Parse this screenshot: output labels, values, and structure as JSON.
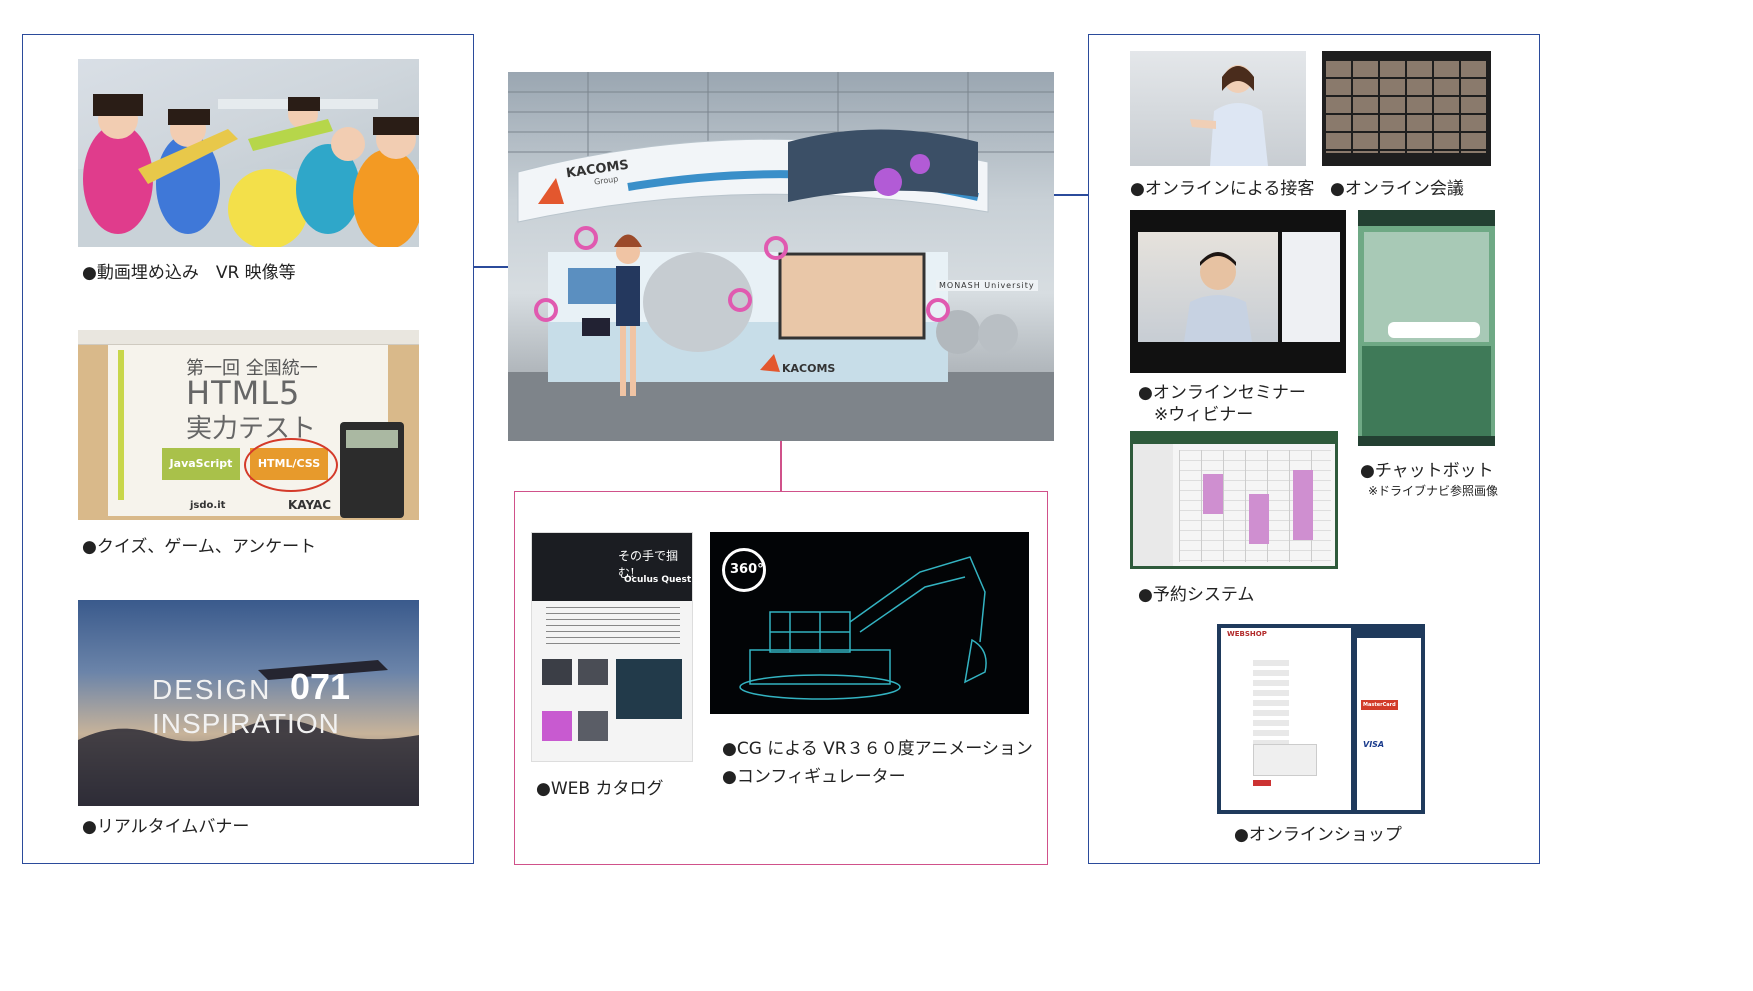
{
  "left_panel": {
    "captions": {
      "video": "●動画埋め込み　VR 映像等",
      "quiz": "●クイズ、ゲーム、アンケート",
      "banner": "●リアルタイムバナー"
    },
    "quiz_image": {
      "title_line1": "第一回 全国統一",
      "title_line2": "HTML5",
      "title_line3": "実力テスト",
      "btn_js": "JavaScript",
      "btn_css": "HTML/CSS",
      "logo_left": "jsdo.it",
      "logo_right": "KAYAC"
    },
    "banner_image": {
      "line1": "DESIGN",
      "number": "071",
      "line2": "INSPIRATION"
    }
  },
  "center": {
    "booth_brand": "KACOMS",
    "booth_brand_sub": "Group",
    "booth_sign": "MONASH University",
    "bottom_panel": {
      "caption_catalog": "●WEB カタログ",
      "caption_cg": "●CG による VR３６０度アニメーション",
      "caption_config": "●コンフィギュレーター",
      "catalog_title": "その手で掴む!",
      "catalog_sub": "Oculus Quest",
      "badge_360": "360°"
    }
  },
  "right_panel": {
    "captions": {
      "reception": "●オンラインによる接客",
      "meeting": "●オンライン会議",
      "seminar": "●オンラインセミナー",
      "seminar_note": "※ウィビナー",
      "chatbot": "●チャットボット",
      "chatbot_note": "※ドライブナビ参照画像",
      "reservation": "●予約システム",
      "shop": "●オンラインショップ"
    },
    "shop_image": {
      "header": "WEBSHOP",
      "card1": "MasterCard",
      "card2": "VISA"
    }
  },
  "colors": {
    "blue_frame": "#2b4b9b",
    "pink_frame": "#d0518a"
  }
}
